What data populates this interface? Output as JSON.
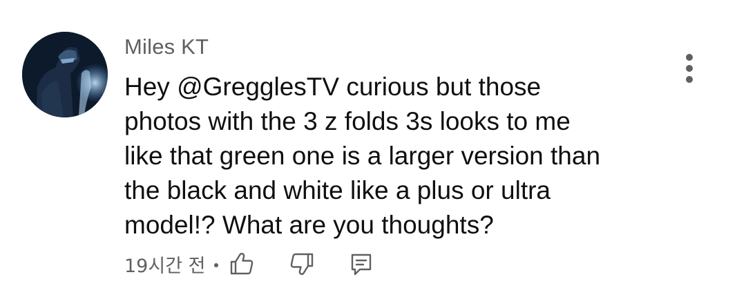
{
  "comment": {
    "author": "Miles KT",
    "text_lines": [
      "Hey @GregglesTV curious but those",
      "photos with the 3 z folds 3s looks to me",
      "like that green one is a larger version than",
      "the black and white like a plus or ultra",
      "model!? What are you thoughts?"
    ],
    "timestamp": "19시간 전",
    "separator": "•"
  },
  "icons": {
    "avatar": "avatar-image",
    "menu": "more-vert-icon",
    "like": "thumb-up-icon",
    "dislike": "thumb-down-icon",
    "reply": "reply-comment-icon"
  },
  "colors": {
    "text_primary": "#0f0f0f",
    "text_secondary": "#606060",
    "background": "#ffffff"
  }
}
